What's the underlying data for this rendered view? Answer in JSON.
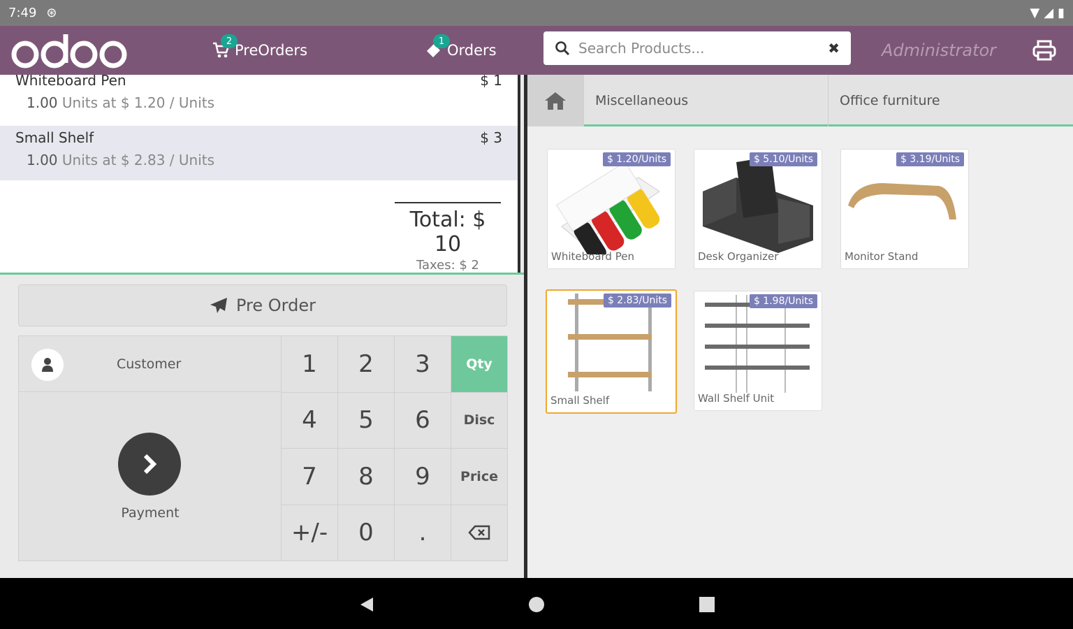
{
  "status_bar": {
    "time": "7:49"
  },
  "header": {
    "logo_text": "odoo",
    "preorders": {
      "label": "PreOrders",
      "badge": "2"
    },
    "orders": {
      "label": "Orders",
      "badge": "1"
    },
    "search": {
      "placeholder": "Search Products..."
    },
    "user": "Administrator"
  },
  "order": {
    "lines": [
      {
        "name": "Whiteboard Pen",
        "price": "$ 1",
        "qty": "1.00",
        "detail": "Units at $ 1.20 / Units"
      },
      {
        "name": "Small Shelf",
        "price": "$ 3",
        "qty": "1.00",
        "detail": "Units at $ 2.83 / Units"
      }
    ],
    "total": "Total: $ 10",
    "taxes": "Taxes: $ 2"
  },
  "actions": {
    "preorder": "Pre Order",
    "customer": "Customer",
    "payment": "Payment"
  },
  "numpad": {
    "keys": [
      "1",
      "2",
      "3",
      "Qty",
      "4",
      "5",
      "6",
      "Disc",
      "7",
      "8",
      "9",
      "Price",
      "+/-",
      "0",
      "."
    ],
    "active_mode": "Qty"
  },
  "categories": [
    "Miscellaneous",
    "Office furniture"
  ],
  "products": [
    {
      "name": "Whiteboard Pen",
      "price": "$ 1.20/Units"
    },
    {
      "name": "Desk Organizer",
      "price": "$ 5.10/Units"
    },
    {
      "name": "Monitor Stand",
      "price": "$ 3.19/Units"
    },
    {
      "name": "Small Shelf",
      "price": "$ 2.83/Units"
    },
    {
      "name": "Wall Shelf Unit",
      "price": "$ 1.98/Units"
    }
  ],
  "colors": {
    "header": "#7c5677",
    "accent": "#6ec89b",
    "badge": "#1ba593",
    "price_tag": "#7b7fb8",
    "selected_product": "#f0a830"
  }
}
